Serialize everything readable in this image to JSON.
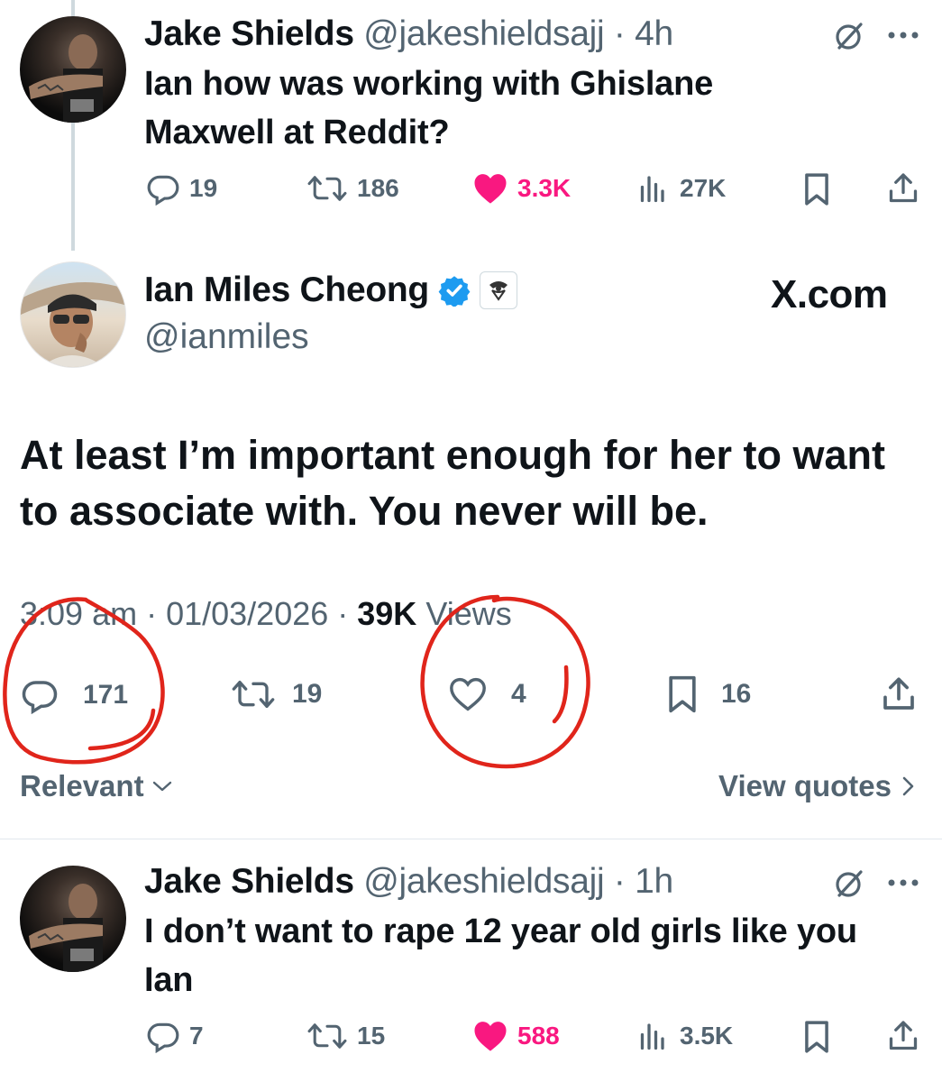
{
  "tweet1": {
    "name": "Jake Shields",
    "handle": "@jakeshieldsajj",
    "time": "4h",
    "text_line1": "Ian how was working with Ghislane",
    "text_line2": "Maxwell at Reddit?",
    "replies": "19",
    "reposts": "186",
    "likes": "3.3K",
    "views": "27K"
  },
  "main_tweet": {
    "name": "Ian Miles Cheong",
    "handle": "@ianmiles",
    "watermark": "X.com",
    "text_line1": "At least I’m important enough for her to want",
    "text_line2": "to associate with. You never will be.",
    "time": "3:09 am",
    "date": "01/03/2026",
    "views_count": "39K",
    "views_label": "Views",
    "replies": "171",
    "reposts": "19",
    "likes": "4",
    "bookmarks": "16"
  },
  "sort": {
    "label": "Relevant"
  },
  "view_quotes": {
    "label": "View quotes"
  },
  "tweet2": {
    "name": "Jake Shields",
    "handle": "@jakeshieldsajj",
    "time": "1h",
    "text_line1": "I don’t want to rape 12 year old girls like you",
    "text_line2": "Ian",
    "replies": "7",
    "reposts": "15",
    "likes": "588",
    "views": "3.5K"
  },
  "colors": {
    "like_pink": "#f91880",
    "muted": "#536471",
    "verified_blue": "#1d9bf0",
    "annotation_red": "#e0251b"
  },
  "icons": [
    "reply-icon",
    "repost-icon",
    "like-icon",
    "views-icon",
    "bookmark-icon",
    "share-icon",
    "grok-icon",
    "more-icon",
    "verified-badge-icon",
    "affiliate-badge-icon",
    "chevron-down-icon",
    "chevron-right-icon"
  ]
}
